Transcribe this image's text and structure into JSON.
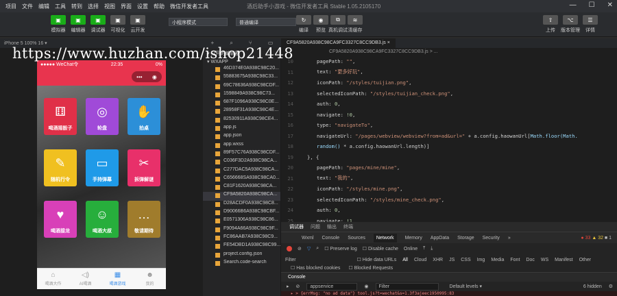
{
  "menu": [
    "项目",
    "文件",
    "编辑",
    "工具",
    "转到",
    "选择",
    "视图",
    "界面",
    "设置",
    "帮助",
    "微信开发者工具"
  ],
  "window_title": "酒后助手小游戏 - 微信开发者工具 Stable 1.05.2105170",
  "toolbar": {
    "buttons": [
      {
        "label": "模拟器",
        "color": "#1aad19"
      },
      {
        "label": "编辑器",
        "color": "#1aad19"
      },
      {
        "label": "调试器",
        "color": "#1aad19"
      },
      {
        "label": "可视化",
        "color": "#555"
      },
      {
        "label": "云开发",
        "color": "#555"
      }
    ],
    "mode": "小程序模式",
    "compile": "普通编译",
    "actions": [
      "编译",
      "预览",
      "真机调试",
      "清缓存"
    ],
    "right": [
      "上传",
      "版本管理",
      "详情"
    ]
  },
  "sim": {
    "device": "iPhone 5 100% 16 ▾",
    "status_left": "●●●●● WeChat令",
    "time": "22:35",
    "battery": "0%",
    "tiles": [
      {
        "label": "喝酒摇骰子",
        "icon": "⚅",
        "color": "#e03048"
      },
      {
        "label": "轮盘",
        "icon": "◎",
        "color": "#a04ad8"
      },
      {
        "label": "拍桌",
        "icon": "✋",
        "color": "#2c8fd8"
      },
      {
        "label": "随机行令",
        "icon": "✎",
        "color": "#f0c020"
      },
      {
        "label": "手持弹幕",
        "icon": "▭",
        "color": "#1f9ae8"
      },
      {
        "label": "拆弹解谜",
        "icon": "✂",
        "color": "#e8306a"
      },
      {
        "label": "喝酒接龙",
        "icon": "♥",
        "color": "#d840b8"
      },
      {
        "label": "喝酒大叔",
        "icon": "☺",
        "color": "#27ae3c"
      },
      {
        "label": "敬请期待",
        "icon": "…",
        "color": "#a07c2c"
      }
    ],
    "tabs": [
      {
        "label": "喝酒大作",
        "icon": "⌂"
      },
      {
        "label": "AI喝酒",
        "icon": "◁)"
      },
      {
        "label": "喝酒游戏",
        "icon": "▦"
      },
      {
        "label": "我的",
        "icon": "☻"
      }
    ]
  },
  "filetree": {
    "sections": [
      "打开的编辑器",
      "WXAPP"
    ],
    "files": [
      "46D374E0A938C98C20...",
      "55883675A938C98C33...",
      "69C78636A938C98CDF...",
      "1598849A938C98C73...",
      "687F1096A938C98C0E...",
      "28958F31A938C98C4E...",
      "82530911A938C98CE4...",
      "app.js",
      "app.json",
      "app.wxss",
      "89F57C76A938C98CDF...",
      "C036F3D2A938C98CA...",
      "C277DAC5A938C98CA...",
      "C656668SA938C98CA0...",
      "C81F1620A938C98CA...",
      "CF9A5820A938C98CA...",
      "D28ACDF0A938C98C8...",
      "D90066B6A938C98CBF...",
      "E0571306A938C98C86...",
      "F9094A66A938C98C9F...",
      "FC86AAB7A938C98C9...",
      "FE54DBD1A938C98C99...",
      "project.config.json",
      "Search.code-search"
    ]
  },
  "editor": {
    "tab": "CF9A5820A938C98CA9FC3327C8CC9DB3.js ×",
    "breadcrumb": "CF9A5820A938C98CA9FC3327C8CC9DB3.js > ...",
    "lines": [
      {
        "n": "",
        "segs": [
          [
            "p",
            "pagePath: "
          ],
          [
            "s",
            "\"\""
          ],
          [
            "p",
            ","
          ]
        ]
      },
      {
        "n": "",
        "segs": [
          [
            "p",
            "text: "
          ],
          [
            "s",
            "\"更多好玩\""
          ],
          [
            "p",
            ","
          ]
        ]
      },
      {
        "n": "",
        "segs": [
          [
            "p",
            "iconPath: "
          ],
          [
            "s",
            "\"/styles/tuijian.png\""
          ],
          [
            "p",
            ","
          ]
        ]
      },
      {
        "n": "",
        "segs": [
          [
            "p",
            "selectedIconPath: "
          ],
          [
            "s",
            "\"/styles/tuijian_check.png\""
          ],
          [
            "p",
            ","
          ]
        ]
      },
      {
        "n": "",
        "segs": [
          [
            "p",
            "auth: "
          ],
          [
            "n",
            "0"
          ],
          [
            "p",
            ","
          ]
        ]
      },
      {
        "n": "",
        "segs": [
          [
            "p",
            "navigate: "
          ],
          [
            "n",
            "!0"
          ],
          [
            "p",
            ","
          ]
        ]
      },
      {
        "n": "",
        "segs": [
          [
            "p",
            "type: "
          ],
          [
            "s",
            "\"navigateTo\""
          ],
          [
            "p",
            ","
          ]
        ]
      },
      {
        "n": "",
        "segs": [
          [
            "p",
            "navigateUrl: "
          ],
          [
            "s",
            "\"/pages/webview/webview?from=ad&url=\""
          ],
          [
            "p",
            " + a.config.haowanUrl["
          ],
          [
            "k",
            "Math.floor(Math."
          ]
        ]
      },
      {
        "n": "",
        "segs": [
          [
            "k",
            "random()"
          ],
          [
            "p",
            " * a.config.haowanUrl.length)]"
          ]
        ]
      },
      {
        "n": "",
        "segs": [
          [
            "p",
            "}, {"
          ]
        ]
      },
      {
        "n": "",
        "segs": [
          [
            "p",
            "pagePath: "
          ],
          [
            "s",
            "\"pages/mine/mine\""
          ],
          [
            "p",
            ","
          ]
        ]
      },
      {
        "n": "",
        "segs": [
          [
            "p",
            "text: "
          ],
          [
            "s",
            "\"我的\""
          ],
          [
            "p",
            ","
          ]
        ]
      },
      {
        "n": "",
        "segs": [
          [
            "p",
            "iconPath: "
          ],
          [
            "s",
            "\"/styles/mine.png\""
          ],
          [
            "p",
            ","
          ]
        ]
      },
      {
        "n": "",
        "segs": [
          [
            "p",
            "selectedIconPath: "
          ],
          [
            "s",
            "\"/styles/mine_check.png\""
          ],
          [
            "p",
            ","
          ]
        ]
      },
      {
        "n": "",
        "segs": [
          [
            "p",
            "auth: "
          ],
          [
            "n",
            "0"
          ],
          [
            "p",
            ","
          ]
        ]
      },
      {
        "n": "",
        "segs": [
          [
            "p",
            "navigate: "
          ],
          [
            "n",
            "!1"
          ]
        ]
      }
    ]
  },
  "devtools": {
    "toptabs": [
      "调试器",
      "问题",
      "输出",
      "终端"
    ],
    "tabs": [
      "Wxml",
      "Console",
      "Sources",
      "Network",
      "Memory",
      "AppData",
      "Storage",
      "Security",
      "»"
    ],
    "active": "Network",
    "errors": "● 33",
    "warns": "▲ 32",
    "infos": "■ 1",
    "preserve": "Preserve log",
    "disable_cache": "Disable cache",
    "online": "Online",
    "filter": "Filter",
    "hide_data": "Hide data URLs",
    "types": [
      "All",
      "Cloud",
      "XHR",
      "JS",
      "CSS",
      "Img",
      "Media",
      "Font",
      "Doc",
      "WS",
      "Manifest",
      "Other"
    ],
    "blocked1": "Has blocked cookies",
    "blocked2": "Blocked Requests",
    "console_label": "Console",
    "context": "appservice",
    "cfilter": "Filter",
    "levels": "Default levels ▾",
    "hidden": "6 hidden",
    "err_line": "▸ > {errMsg: \"no ad data\"}          tool.js?t=wechat&s=1.3f3ajeec1950995:83"
  },
  "watermark": "https://www.huzhan.com/ishop21448"
}
